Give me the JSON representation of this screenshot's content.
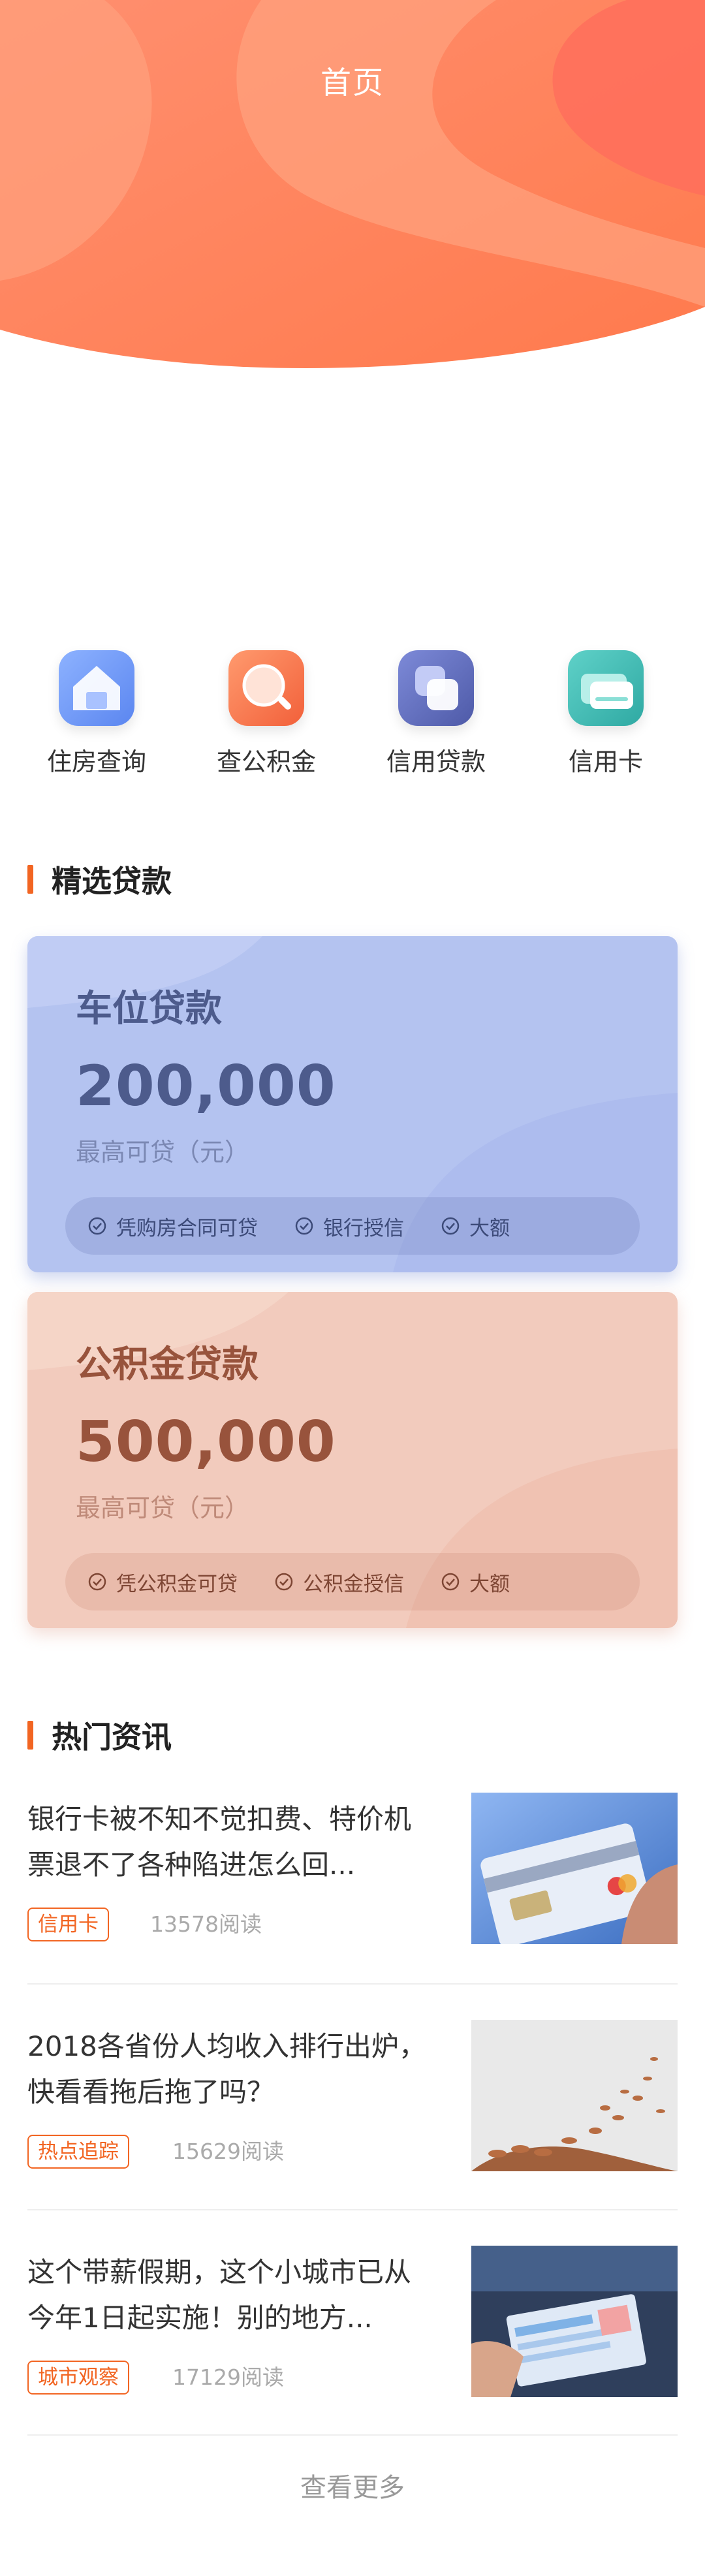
{
  "header": {
    "title": "首页"
  },
  "quick_nav": [
    {
      "label": "住房查询",
      "icon": "house-icon"
    },
    {
      "label": "查公积金",
      "icon": "magnifier-icon"
    },
    {
      "label": "信用贷款",
      "icon": "stacked-squares-icon"
    },
    {
      "label": "信用卡",
      "icon": "credit-card-icon"
    }
  ],
  "featured": {
    "title": "精选贷款",
    "cards": [
      {
        "title": "车位贷款",
        "amount": "200,000",
        "amount_label": "最高可贷（元）",
        "tags": [
          "凭购房合同可贷",
          "银行授信",
          "大额"
        ],
        "color": "#b4c3f0"
      },
      {
        "title": "公积金贷款",
        "amount": "500,000",
        "amount_label": "最高可贷（元）",
        "tags": [
          "凭公积金可贷",
          "公积金授信",
          "大额"
        ],
        "color": "#f2cbbd"
      }
    ]
  },
  "news": {
    "title": "热门资讯",
    "items": [
      {
        "title": "银行卡被不知不觉扣费、特价机票退不了各种陷进怎么回...",
        "tag": "信用卡",
        "reads": "13578阅读"
      },
      {
        "title": "2018各省份人均收入排行出炉，快看看拖后拖了吗？",
        "tag": "热点追踪",
        "reads": "15629阅读"
      },
      {
        "title": "这个带薪假期，这个小城市已从今年1日起实施！别的地方...",
        "tag": "城市观察",
        "reads": "17129阅读"
      }
    ],
    "more_label": "查看更多"
  },
  "colors": {
    "accent": "#f26522",
    "header_gradient_start": "#ff9270",
    "header_gradient_end": "#ff7a4a"
  }
}
